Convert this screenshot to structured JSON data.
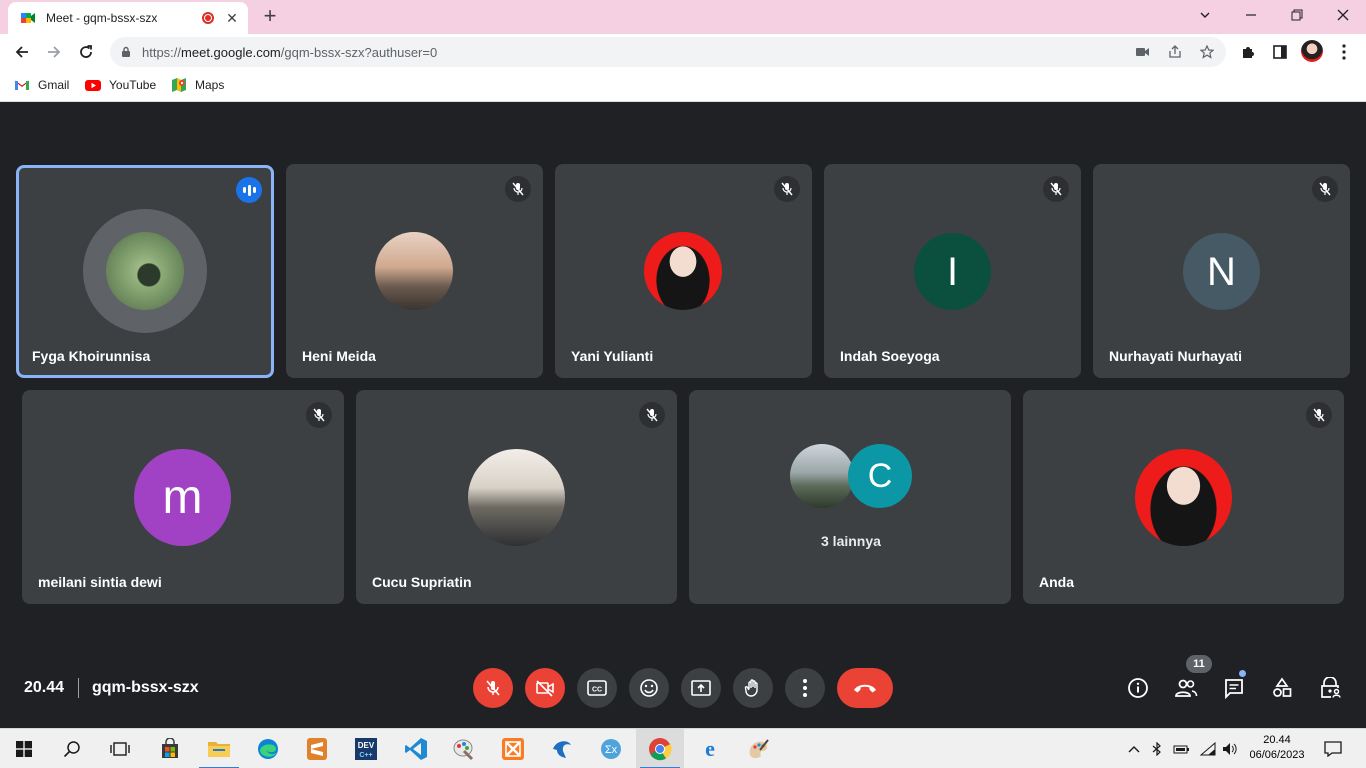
{
  "browser": {
    "tab_title": "Meet - gqm-bssx-szx",
    "url_prefix": "https://",
    "url_host": "meet.google.com",
    "url_path": "/gqm-bssx-szx?authuser=0",
    "bookmarks": [
      {
        "label": "Gmail",
        "icon": "gmail-icon"
      },
      {
        "label": "YouTube",
        "icon": "youtube-icon"
      },
      {
        "label": "Maps",
        "icon": "maps-icon"
      }
    ]
  },
  "meeting": {
    "participants_row1": [
      {
        "name": "Fyga Khoirunnisa",
        "speaking": true,
        "avatar": "photo"
      },
      {
        "name": "Heni Meida",
        "muted": true,
        "avatar": "photo"
      },
      {
        "name": "Yani Yulianti",
        "muted": true,
        "avatar": "photo"
      },
      {
        "name": "Indah Soeyoga",
        "muted": true,
        "avatar": "initial",
        "initial": "I",
        "color": "#0b4f3f"
      },
      {
        "name": "Nurhayati Nurhayati",
        "muted": true,
        "avatar": "initial",
        "initial": "N",
        "color": "#455a64"
      }
    ],
    "participants_row2": [
      {
        "name": "meilani sintia dewi",
        "muted": true,
        "avatar": "initial",
        "initial": "m",
        "color": "#a142c4"
      },
      {
        "name": "Cucu Supriatin",
        "muted": true,
        "avatar": "photo"
      },
      {
        "name": "3 lainnya",
        "avatar": "group",
        "initial": "C",
        "color": "#0b97a6"
      },
      {
        "name": "Anda",
        "muted": true,
        "avatar": "photo"
      }
    ],
    "time": "20.44",
    "code": "gqm-bssx-szx",
    "participant_count": "11",
    "accent": "#8ab4f8",
    "danger": "#ea4335"
  },
  "controls": [
    {
      "name": "mic-off",
      "icon": "mic-off-icon"
    },
    {
      "name": "camera-off",
      "icon": "camera-off-icon"
    },
    {
      "name": "captions",
      "icon": "captions-icon"
    },
    {
      "name": "reactions",
      "icon": "emoji-icon"
    },
    {
      "name": "present",
      "icon": "present-icon"
    },
    {
      "name": "raise-hand",
      "icon": "hand-icon"
    },
    {
      "name": "more-options",
      "icon": "more-vert-icon"
    },
    {
      "name": "leave-call",
      "icon": "call-end-icon"
    }
  ],
  "taskbar": {
    "time": "20.44",
    "date": "06/06/2023"
  }
}
